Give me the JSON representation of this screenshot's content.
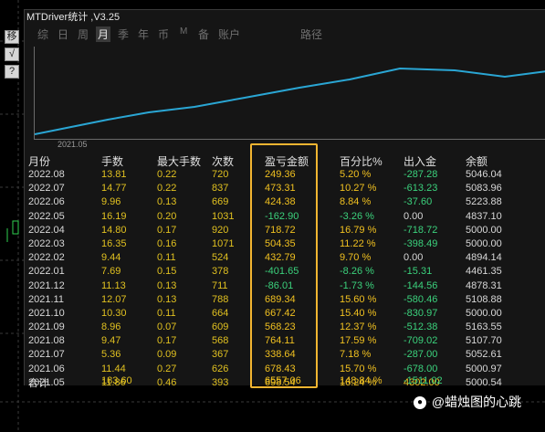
{
  "window": {
    "title": "MTDriver统计 ,V3.25"
  },
  "toolbar": {
    "buttons": [
      "移",
      "√",
      "?"
    ]
  },
  "tabs": [
    "综",
    "日",
    "周",
    "月",
    "季",
    "年",
    "币",
    "M",
    "备",
    "账户",
    "路径"
  ],
  "active_tab": "月",
  "chart": {
    "start_label": "2021.05",
    "line_color": "#2aa6d4"
  },
  "table": {
    "headers": [
      "月份",
      "手数",
      "最大手数",
      "次数",
      "盈亏金额",
      "百分比%",
      "出入金",
      "余额"
    ],
    "rows": [
      [
        "2022.08",
        "13.81",
        "0.22",
        "720",
        "249.36",
        "5.20 %",
        "-287.28",
        "5046.04"
      ],
      [
        "2022.07",
        "14.77",
        "0.22",
        "837",
        "473.31",
        "10.27 %",
        "-613.23",
        "5083.96"
      ],
      [
        "2022.06",
        "9.96",
        "0.13",
        "669",
        "424.38",
        "8.84 %",
        "-37.60",
        "5223.88"
      ],
      [
        "2022.05",
        "16.19",
        "0.20",
        "1031",
        "-162.90",
        "-3.26 %",
        "0.00",
        "4837.10"
      ],
      [
        "2022.04",
        "14.80",
        "0.17",
        "920",
        "718.72",
        "16.79 %",
        "-718.72",
        "5000.00"
      ],
      [
        "2022.03",
        "16.35",
        "0.16",
        "1071",
        "504.35",
        "11.22 %",
        "-398.49",
        "5000.00"
      ],
      [
        "2022.02",
        "9.44",
        "0.11",
        "524",
        "432.79",
        "9.70 %",
        "0.00",
        "4894.14"
      ],
      [
        "2022.01",
        "7.69",
        "0.15",
        "378",
        "-401.65",
        "-8.26 %",
        "-15.31",
        "4461.35"
      ],
      [
        "2021.12",
        "11.13",
        "0.13",
        "711",
        "-86.01",
        "-1.73 %",
        "-144.56",
        "4878.31"
      ],
      [
        "2021.11",
        "12.07",
        "0.13",
        "788",
        "689.34",
        "15.60 %",
        "-580.46",
        "5108.88"
      ],
      [
        "2021.10",
        "10.30",
        "0.11",
        "664",
        "667.42",
        "15.40 %",
        "-830.97",
        "5000.00"
      ],
      [
        "2021.09",
        "8.96",
        "0.07",
        "609",
        "568.23",
        "12.37 %",
        "-512.38",
        "5163.55"
      ],
      [
        "2021.08",
        "9.47",
        "0.17",
        "568",
        "764.11",
        "17.59 %",
        "-709.02",
        "5107.70"
      ],
      [
        "2021.07",
        "5.36",
        "0.09",
        "367",
        "338.64",
        "7.18 %",
        "-287.00",
        "5052.61"
      ],
      [
        "2021.06",
        "11.44",
        "0.27",
        "626",
        "678.43",
        "15.70 %",
        "-678.00",
        "5000.97"
      ],
      [
        "2021.05",
        "11.86",
        "0.46",
        "393",
        "698.54",
        "16.24 %",
        "4302.00",
        "5000.54"
      ]
    ],
    "totals": {
      "label": "合计",
      "lots": "183.60",
      "profit": "6557.06",
      "percent": "148.84 %",
      "deposit": "-1511.02"
    }
  },
  "watermark": {
    "text": "@蜡烛图的心跳"
  },
  "colors": {
    "positive": "#f0c020",
    "negative": "#3bd17c",
    "highlight": "#f2b531"
  }
}
